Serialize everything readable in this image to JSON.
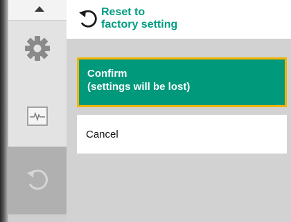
{
  "header": {
    "title_line1": "Reset to",
    "title_line2": "factory setting",
    "icon": "reset-arrow-icon"
  },
  "sidebar": {
    "items": [
      {
        "icon": "chevron-up-icon"
      },
      {
        "icon": "gear-icon"
      },
      {
        "icon": "diagnostics-monitor-icon"
      },
      {
        "icon": "reset-arrow-icon",
        "active": true
      }
    ]
  },
  "menu": {
    "confirm_line1": "Confirm",
    "confirm_line2": "(settings will be lost)",
    "cancel": "Cancel"
  },
  "colors": {
    "accent": "#009c82",
    "selection_border": "#f2b400",
    "selected_bg": "#00997c"
  }
}
